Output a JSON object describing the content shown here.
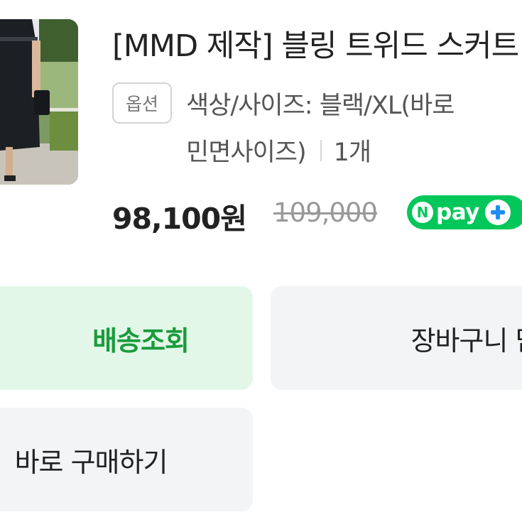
{
  "product": {
    "title": "[MMD 제작] 블링 트위드 스커트",
    "option_badge": "옵션",
    "option_line1": "색상/사이즈: 블랙/XL(바로",
    "option_line2": "민면사이즈)",
    "quantity": "1개",
    "price": "98,100원",
    "original_price": "109,000"
  },
  "npay": {
    "n_letter": "N",
    "label": "pay"
  },
  "buttons": {
    "track_delivery": "배송조회",
    "add_to_cart": "장바구니 담기",
    "buy_now": "바로 구매하기"
  },
  "colors": {
    "accent_green": "#03c75a",
    "track_button_bg": "#e3f7e8",
    "track_button_text": "#1a9b3c"
  }
}
